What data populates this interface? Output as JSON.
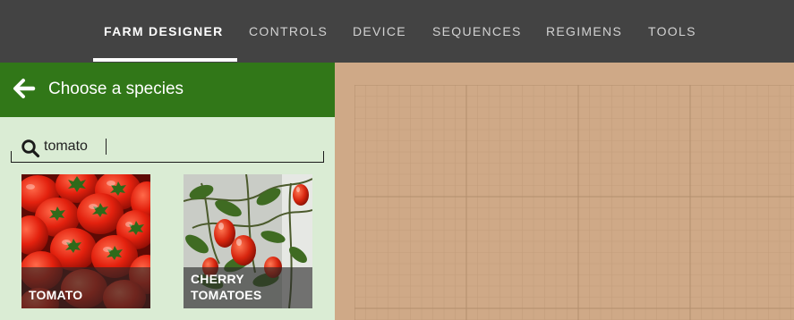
{
  "nav": {
    "items": [
      {
        "label": "FARM DESIGNER",
        "active": true
      },
      {
        "label": "CONTROLS",
        "active": false
      },
      {
        "label": "DEVICE",
        "active": false
      },
      {
        "label": "SEQUENCES",
        "active": false
      },
      {
        "label": "REGIMENS",
        "active": false
      },
      {
        "label": "TOOLS",
        "active": false
      }
    ]
  },
  "panel": {
    "title": "Choose a species",
    "back_icon": "arrow-left-icon",
    "search": {
      "value": "tomato",
      "icon": "search-icon"
    },
    "results": [
      {
        "label": "TOMATO"
      },
      {
        "label_lines": [
          "CHERRY",
          "TOMATOES"
        ]
      }
    ]
  },
  "colors": {
    "nav_bg": "#434343",
    "panel_header": "#317718",
    "panel_bg": "#daecd4",
    "garden_bg": "#cfa987"
  }
}
